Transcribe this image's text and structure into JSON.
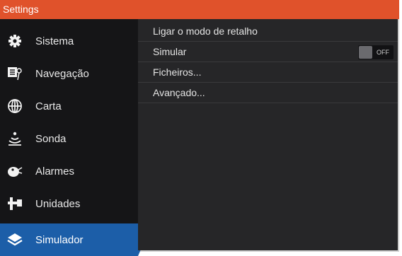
{
  "title": "Settings",
  "sidebar": {
    "items": [
      {
        "label": "Sistema",
        "icon": "gear-icon"
      },
      {
        "label": "Navegação",
        "icon": "navigation-icon"
      },
      {
        "label": "Carta",
        "icon": "globe-icon"
      },
      {
        "label": "Sonda",
        "icon": "sonar-icon"
      },
      {
        "label": "Alarmes",
        "icon": "alarm-icon"
      },
      {
        "label": "Unidades",
        "icon": "units-icon"
      },
      {
        "label": "Simulador",
        "icon": "layers-icon",
        "active": true
      }
    ]
  },
  "main": {
    "rows": [
      {
        "label": "Ligar o modo de retalho"
      },
      {
        "label": "Simular",
        "toggle": "OFF"
      },
      {
        "label": "Ficheiros..."
      },
      {
        "label": "Avançado..."
      }
    ]
  },
  "colors": {
    "titlebar": "#e0522b",
    "active": "#1c5ea8",
    "sidebar": "#151517",
    "panel": "#262628"
  }
}
